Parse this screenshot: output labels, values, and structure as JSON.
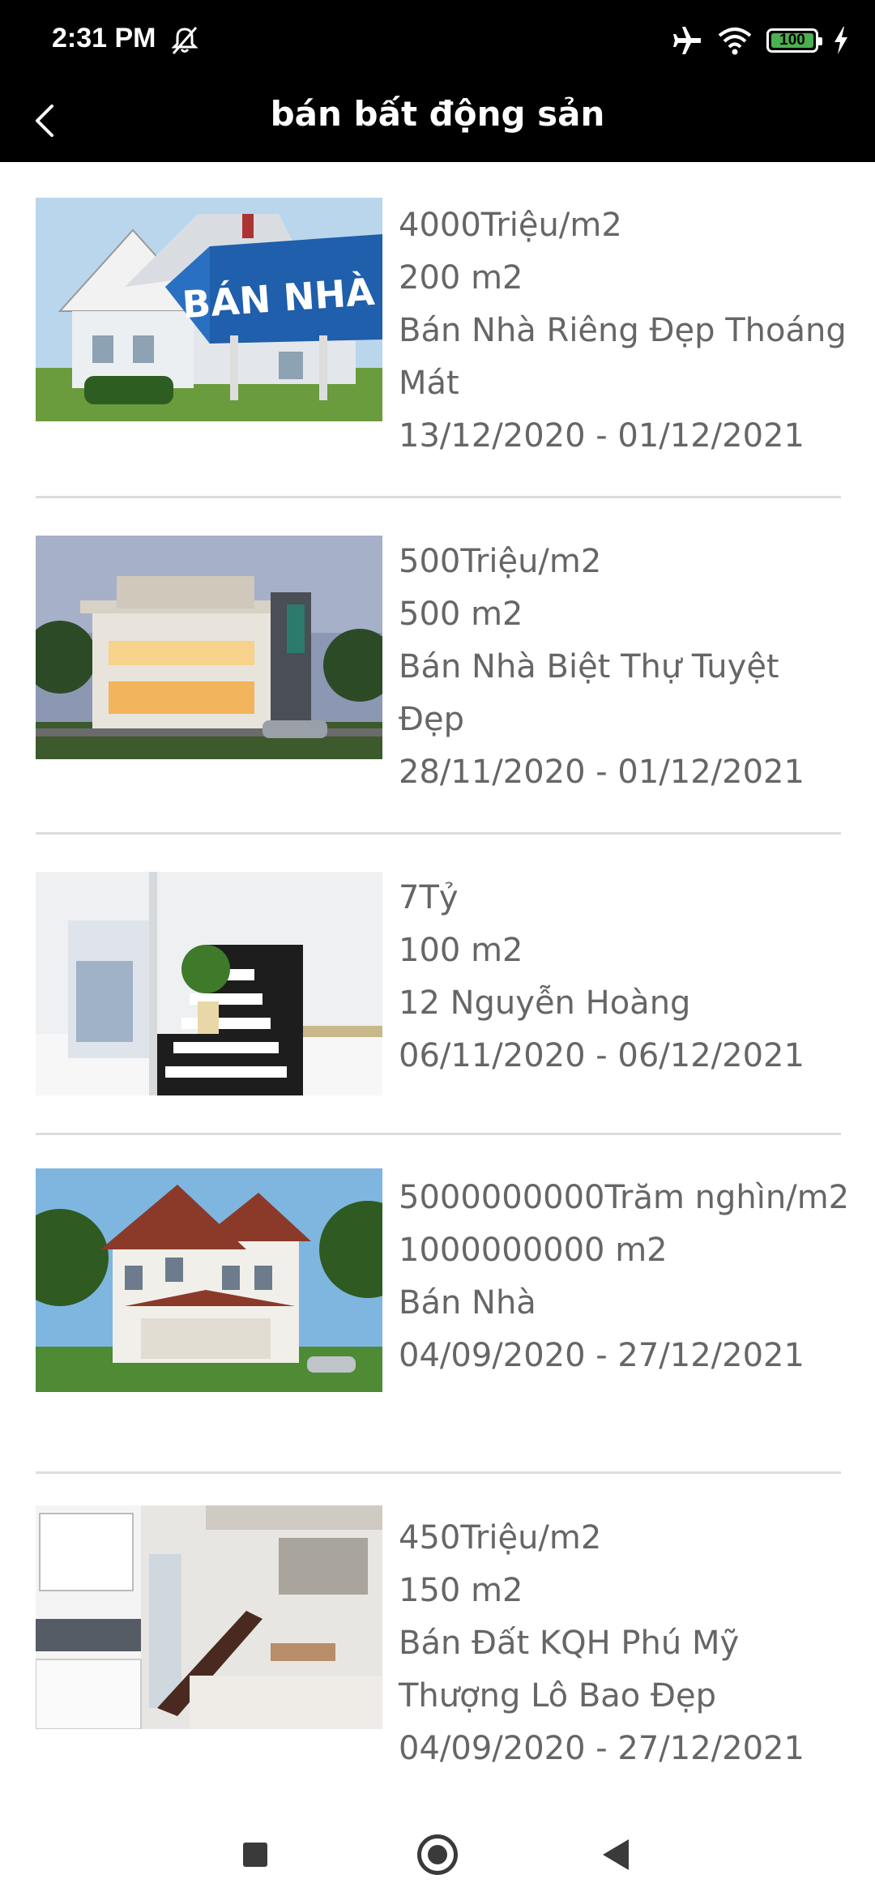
{
  "status_bar": {
    "time": "2:31 PM",
    "battery": "100",
    "icons": [
      "mute-icon",
      "airplane-icon",
      "wifi-icon",
      "battery-icon",
      "charging-icon"
    ]
  },
  "app_bar": {
    "title": "bán bất động sản",
    "back_icon": "chevron-left-icon"
  },
  "listings": [
    {
      "price": "4000Triệu/m2",
      "area": "200 m2",
      "title": "Bán Nhà Riêng Đẹp Thoáng Mát",
      "dates": "13/12/2020 - 01/12/2021",
      "image_caption": "BÁN NHÀ"
    },
    {
      "price": "500Triệu/m2",
      "area": "500 m2",
      "title": "Bán Nhà Biệt Thự Tuyệt Đẹp",
      "dates": "28/11/2020 - 01/12/2021"
    },
    {
      "price": "7Tỷ",
      "area": "100 m2",
      "title": "12 Nguyễn Hoàng",
      "dates": "06/11/2020 - 06/12/2021"
    },
    {
      "price": "5000000000Trăm nghìn/m2",
      "area": "1000000000 m2",
      "title": "Bán Nhà",
      "dates": "04/09/2020 - 27/12/2021"
    },
    {
      "price": "450Triệu/m2",
      "area": "150 m2",
      "title": "Bán Đất KQH Phú Mỹ Thượng Lô Bao Đẹp",
      "dates": "04/09/2020 - 27/12/2021"
    }
  ],
  "nav_bar": {
    "icons": [
      "recents-icon",
      "home-icon",
      "back-icon"
    ]
  },
  "colors": {
    "bar_background": "#000000",
    "text_secondary": "#666666",
    "divider": "#dcdcdc"
  }
}
